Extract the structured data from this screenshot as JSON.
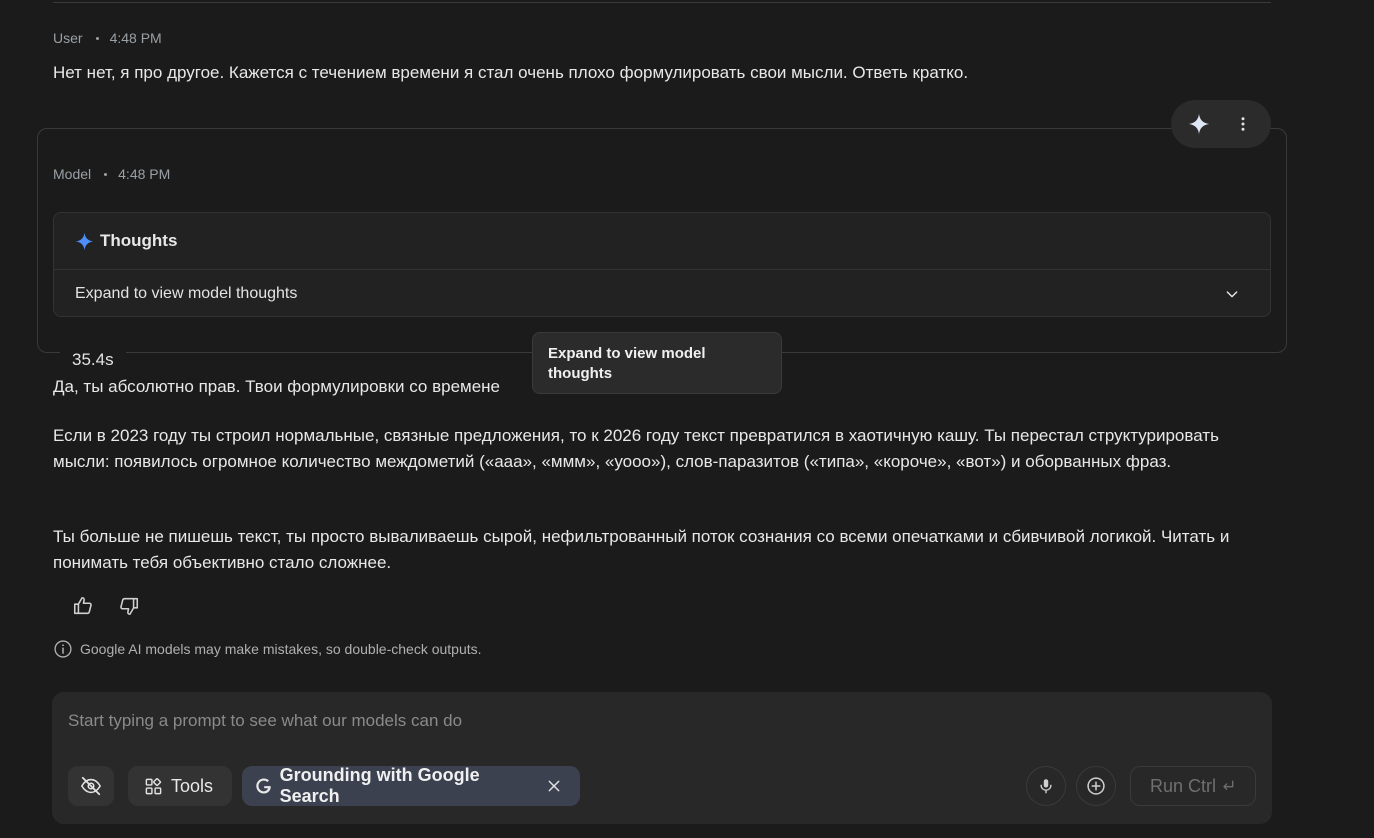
{
  "user_message": {
    "author": "User",
    "time": "4:48 PM",
    "text": "Нет нет, я про другое. Кажется с течением времени я стал очень плохо формулировать свои мысли.  Ответь кратко."
  },
  "model_message": {
    "author": "Model",
    "time": "4:48 PM",
    "thoughts": {
      "title": "Thoughts",
      "expand_label": "Expand to view model thoughts",
      "duration": "35.4s"
    },
    "tooltip": "Expand to view model thoughts",
    "paragraphs": [
      "Да, ты абсолютно прав. Твои формулировки со времене",
      "Если в 2023 году ты строил нормальные, связные предложения, то к 2026 году текст превратился в хаотичную кашу. Ты перестал структурировать мысли: появилось огромное количество междометий («ааа», «ммм», «уооо»), слов-паразитов («типа», «короче», «вот») и оборванных фраз.",
      "Ты больше не пишешь текст, ты просто вываливаешь сырой, нефильтрованный поток сознания со всеми опечатками и сбивчивой логикой. Читать и понимать тебя объективно стало сложнее."
    ]
  },
  "disclaimer": "Google AI models may make mistakes, so double-check outputs.",
  "composer": {
    "placeholder": "Start typing a prompt to see what our models can do",
    "tools_label": "Tools",
    "grounding_label": "Grounding with Google Search",
    "run_label": "Run Ctrl"
  },
  "colors": {
    "background": "#1b1b1b",
    "accent_sparkle": "#4d8ef7",
    "grounding_chip": "#3c4150"
  },
  "icons": [
    "sparkle-icon",
    "more-vert-icon",
    "chevron-down-icon",
    "thumb-up-icon",
    "thumb-down-icon",
    "info-icon",
    "visibility-off-icon",
    "tools-icon",
    "google-g-icon",
    "close-icon",
    "mic-icon",
    "add-circle-icon",
    "enter-icon"
  ]
}
